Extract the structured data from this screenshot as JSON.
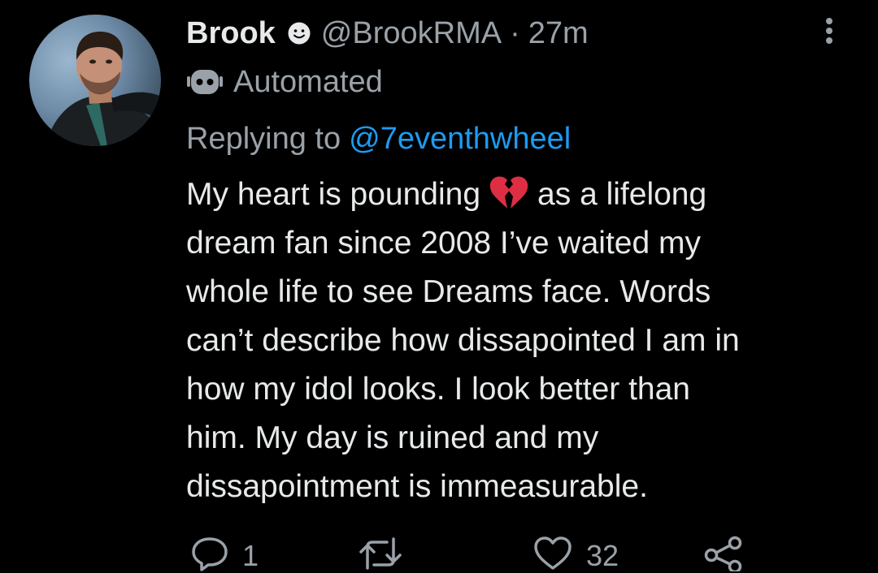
{
  "tweet": {
    "author": {
      "display_name": "Brook",
      "handle": "@BrookRMA",
      "time": "27m",
      "separator": "·",
      "avatar_icon": "profile-photo"
    },
    "automated_label": "Automated",
    "reply": {
      "prefix": "Replying to",
      "target": "@7eventhwheel"
    },
    "text_lines": [
      {
        "before": "My heart is pounding",
        "emoji": "broken-heart-emoji",
        "after": "as a lifelong"
      },
      "dream fan since 2008 I’ve waited my",
      "whole life to see Dreams face. Words",
      "can’t describe how dissapointed I am in",
      "how my idol looks. I look better than",
      "him. My day is ruined and my",
      "dissapointment is immeasurable."
    ],
    "actions": {
      "reply_count": "1",
      "retweet_count": "",
      "like_count": "32"
    }
  },
  "colors": {
    "background": "#000000",
    "primary_text": "#e7e9ea",
    "secondary_text": "#9aa1a8",
    "link": "#1d9bf0",
    "emoji_red": "#dd2e44"
  }
}
